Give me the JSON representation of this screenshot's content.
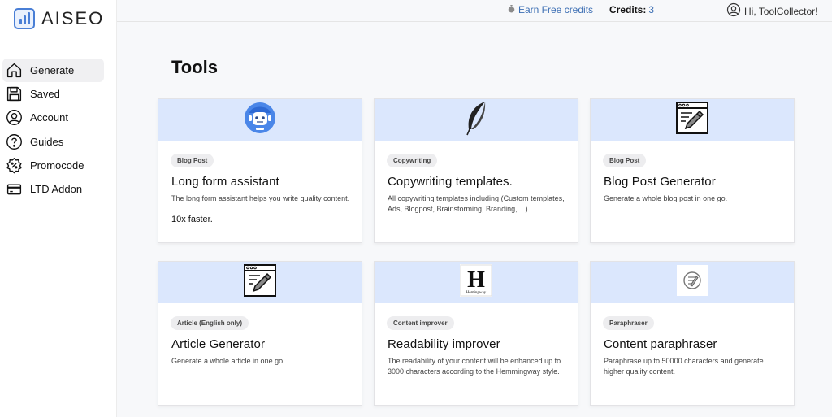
{
  "brand": {
    "name": "AISEO"
  },
  "sidebar": {
    "items": [
      {
        "label": "Generate",
        "icon": "home-icon",
        "active": true
      },
      {
        "label": "Saved",
        "icon": "save-icon",
        "active": false
      },
      {
        "label": "Account",
        "icon": "user-icon",
        "active": false
      },
      {
        "label": "Guides",
        "icon": "help-icon",
        "active": false
      },
      {
        "label": "Promocode",
        "icon": "percent-badge-icon",
        "active": false
      },
      {
        "label": "LTD Addon",
        "icon": "credit-card-icon",
        "active": false
      }
    ]
  },
  "topbar": {
    "earn_label": "Earn Free credits",
    "credits_label": "Credits:",
    "credits_value": "3",
    "greeting": "Hi, ToolCollector!"
  },
  "page": {
    "title": "Tools"
  },
  "tools": [
    {
      "badge": "Blog Post",
      "title": "Long form assistant",
      "description": "The long form assistant helps you write quality content.",
      "extra": "10x faster.",
      "icon": "robot-icon"
    },
    {
      "badge": "Copywriting",
      "title": "Copywriting templates.",
      "description": "All copywriting templates including (Custom templates, Ads, Blogpost, Brainstorming, Branding, ...).",
      "extra": "",
      "icon": "feather-icon"
    },
    {
      "badge": "Blog Post",
      "title": "Blog Post Generator",
      "description": "Generate a whole blog post in one go.",
      "extra": "",
      "icon": "browser-pencil-icon"
    },
    {
      "badge": "Article (English only)",
      "title": "Article Generator",
      "description": "Generate a whole article in one go.",
      "extra": "",
      "icon": "browser-pencil-icon"
    },
    {
      "badge": "Content improver",
      "title": "Readability improver",
      "description": "The readability of your content will be enhanced up to 3000 characters according to the Hemmingway style.",
      "extra": "",
      "icon": "hemingway-logo",
      "logo_text": "Hemingway"
    },
    {
      "badge": "Paraphraser",
      "title": "Content paraphraser",
      "description": "Paraphrase up to 50000 characters and generate higher quality content.",
      "extra": "",
      "icon": "paraphrase-icon"
    }
  ],
  "colors": {
    "accent": "#3d6fb4",
    "card_band": "#dbe7fd",
    "logo_blue": "#4a7fd6"
  }
}
